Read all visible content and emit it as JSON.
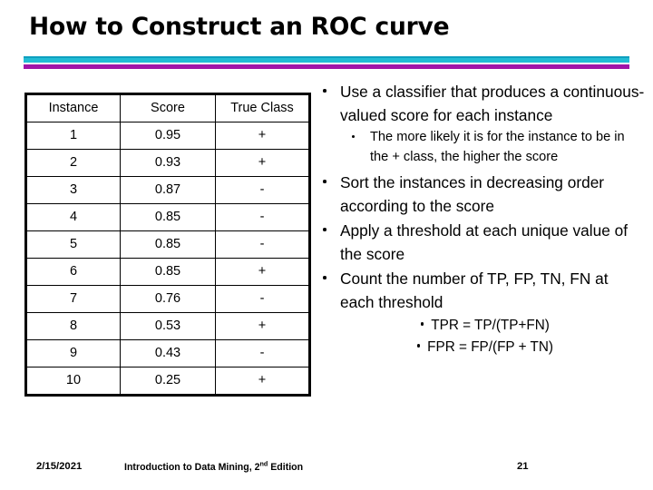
{
  "slide": {
    "title": "How to Construct an ROC curve",
    "accent_cyan_dark": "#0E9FBF",
    "accent_cyan": "#22BCD4",
    "accent_purple": "#A015A8"
  },
  "table": {
    "headers": [
      "Instance",
      "Score",
      "True Class"
    ],
    "rows": [
      [
        "1",
        "0.95",
        "+"
      ],
      [
        "2",
        "0.93",
        "+"
      ],
      [
        "3",
        "0.87",
        "-"
      ],
      [
        "4",
        "0.85",
        "-"
      ],
      [
        "5",
        "0.85",
        "-"
      ],
      [
        "6",
        "0.85",
        "+"
      ],
      [
        "7",
        "0.76",
        "-"
      ],
      [
        "8",
        "0.53",
        "+"
      ],
      [
        "9",
        "0.43",
        "-"
      ],
      [
        "10",
        "0.25",
        "+"
      ]
    ]
  },
  "content": {
    "bullet1": "Use a classifier that produces a continuous-valued score for each instance",
    "sub1": "The more likely it is for the instance to be in the + class, the higher the score",
    "bullet2": "Sort the instances in decreasing order according to the score",
    "bullet3": "Apply a threshold at each unique value of the score",
    "bullet4": "Count the number of TP, FP, TN, FN at each threshold",
    "formula_tpr": "TPR = TP/(TP+FN)",
    "formula_fpr": "FPR = FP/(FP + TN)"
  },
  "footer": {
    "date": "2/15/2021",
    "source_prefix": "Introduction to Data Mining, 2",
    "source_sup": "nd",
    "source_suffix": " Edition",
    "page": "21"
  }
}
